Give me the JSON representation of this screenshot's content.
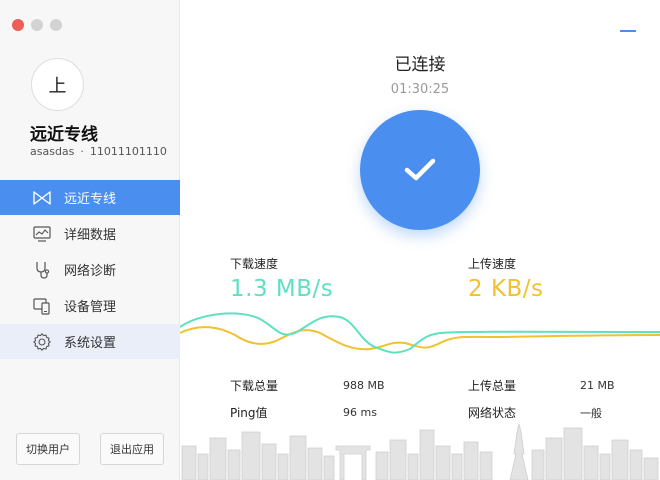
{
  "sidebar": {
    "avatar_char": "上",
    "user_name": "远近专线",
    "user_id": "asasdas",
    "user_phone": "11011101110",
    "items": [
      {
        "label": "远近专线",
        "icon": "bowtie-icon"
      },
      {
        "label": "详细数据",
        "icon": "monitor-chart-icon"
      },
      {
        "label": "网络诊断",
        "icon": "stethoscope-icon"
      },
      {
        "label": "设备管理",
        "icon": "devices-icon"
      },
      {
        "label": "系统设置",
        "icon": "gear-icon"
      }
    ],
    "switch_user": "切换用户",
    "exit_app": "退出应用"
  },
  "main": {
    "status": "已连接",
    "timer": "01:30:25",
    "download": {
      "label": "下载速度",
      "value": "1.3 MB/s"
    },
    "upload": {
      "label": "上传速度",
      "value": "2 KB/s"
    },
    "stats_left": [
      {
        "key": "下载总量",
        "value": "988 MB"
      },
      {
        "key": "Ping值",
        "value": "96 ms"
      }
    ],
    "stats_right": [
      {
        "key": "上传总量",
        "value": "21 MB"
      },
      {
        "key": "网络状态",
        "value": "一般"
      }
    ]
  },
  "colors": {
    "accent": "#4a8ef0",
    "download": "#5fe0c2",
    "upload": "#f2c12e",
    "close": "#ec5f57"
  }
}
